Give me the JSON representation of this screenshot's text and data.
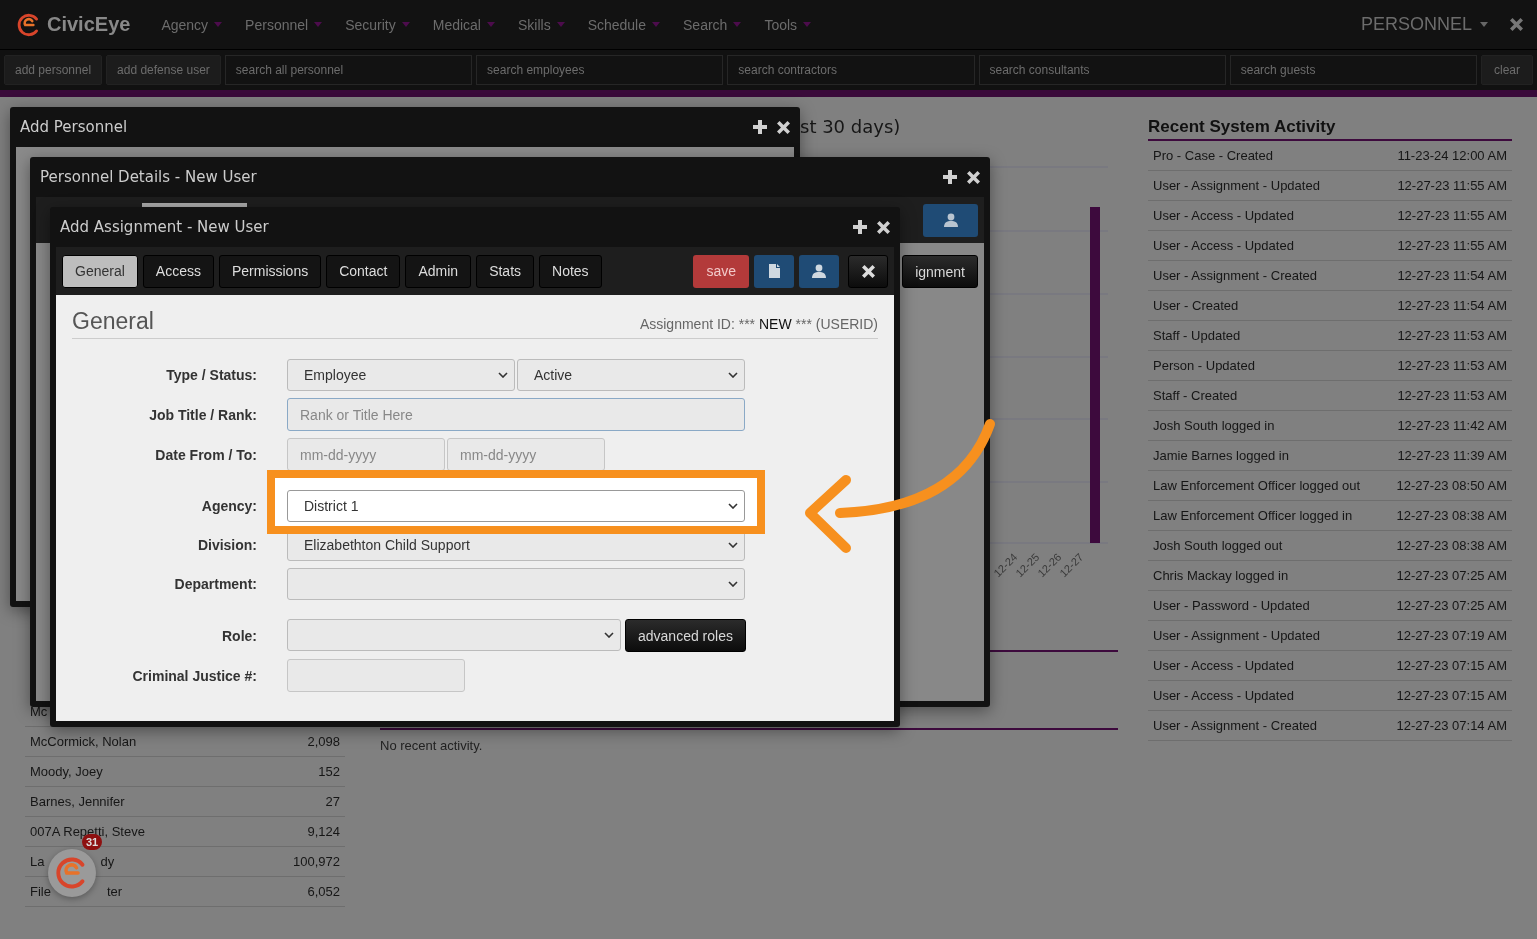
{
  "nav": {
    "brand": "CivicEye",
    "menus": [
      "Agency",
      "Personnel",
      "Security",
      "Medical",
      "Skills",
      "Schedule",
      "Search",
      "Tools"
    ],
    "context": "PERSONNEL"
  },
  "toolbar": {
    "buttons": [
      "add personnel",
      "add defense user"
    ],
    "search_placeholders": [
      "search all personnel",
      "search employees",
      "search contractors",
      "search consultants",
      "search guests"
    ],
    "clear": "clear"
  },
  "leaderboard": {
    "rows": [
      {
        "name": "Mc"
      },
      {
        "name": "McCormick, Nolan",
        "count": "2,098"
      },
      {
        "name": "Moody, Joey",
        "count": "152"
      },
      {
        "name": "Barnes, Jennifer",
        "count": "27"
      },
      {
        "name": "007A Repetti, Steve",
        "count": "9,124"
      },
      {
        "name": "La",
        "name_tail": "dy",
        "count": "100,972"
      },
      {
        "name": "File",
        "name_tail": "ter",
        "count": "6,052"
      }
    ]
  },
  "chart_panel": {
    "title": "st 30 days)",
    "x_labels": [
      "12-24",
      "12-25",
      "12-26",
      "12-27"
    ],
    "empty_text": "No recent activity."
  },
  "activity": {
    "title": "Recent System Activity",
    "rows": [
      {
        "event": "Pro - Case - Created",
        "time": "11-23-24 12:00 AM"
      },
      {
        "event": "User - Assignment - Updated",
        "time": "12-27-23 11:55 AM"
      },
      {
        "event": "User - Access - Updated",
        "time": "12-27-23 11:55 AM"
      },
      {
        "event": "User - Access - Updated",
        "time": "12-27-23 11:55 AM"
      },
      {
        "event": "User - Assignment - Created",
        "time": "12-27-23 11:54 AM"
      },
      {
        "event": "User - Created",
        "time": "12-27-23 11:54 AM"
      },
      {
        "event": "Staff - Updated",
        "time": "12-27-23 11:53 AM"
      },
      {
        "event": "Person - Updated",
        "time": "12-27-23 11:53 AM"
      },
      {
        "event": "Staff - Created",
        "time": "12-27-23 11:53 AM"
      },
      {
        "event": "Josh South logged in",
        "time": "12-27-23 11:42 AM"
      },
      {
        "event": "Jamie Barnes logged in",
        "time": "12-27-23 11:39 AM"
      },
      {
        "event": "Law Enforcement Officer logged out",
        "time": "12-27-23 08:50 AM"
      },
      {
        "event": "Law Enforcement Officer logged in",
        "time": "12-27-23 08:38 AM"
      },
      {
        "event": "Josh South logged out",
        "time": "12-27-23 08:38 AM"
      },
      {
        "event": "Chris Mackay logged in",
        "time": "12-27-23 07:25 AM"
      },
      {
        "event": "User - Password - Updated",
        "time": "12-27-23 07:25 AM"
      },
      {
        "event": "User - Assignment - Updated",
        "time": "12-27-23 07:19 AM"
      },
      {
        "event": "User - Access - Updated",
        "time": "12-27-23 07:15 AM"
      },
      {
        "event": "User - Access - Updated",
        "time": "12-27-23 07:15 AM"
      },
      {
        "event": "User - Assignment - Created",
        "time": "12-27-23 07:14 AM"
      }
    ]
  },
  "add_personnel_window": {
    "title": "Add Personnel"
  },
  "personnel_details_window": {
    "title": "Personnel Details - New User",
    "button": "ignment"
  },
  "assignment_window": {
    "title": "Add Assignment - New User",
    "tabs": [
      {
        "label": "General",
        "selected": true
      },
      {
        "label": "Access",
        "selected": false
      },
      {
        "label": "Permissions",
        "selected": false
      },
      {
        "label": "Contact",
        "selected": false
      },
      {
        "label": "Admin",
        "selected": false
      },
      {
        "label": "Stats",
        "selected": false
      },
      {
        "label": "Notes",
        "selected": false
      }
    ],
    "save": "save",
    "section": "General",
    "assignment_id": {
      "prefix": "Assignment ID: ***",
      "value": "NEW",
      "suffix": "*** (USERID)"
    },
    "fields": [
      {
        "kind": "select_pair",
        "label": "Type / Status:",
        "values": [
          "Employee",
          "Active"
        ]
      },
      {
        "kind": "text",
        "label": "Job Title / Rank:",
        "placeholder": "Rank or Title Here",
        "focused": true
      },
      {
        "kind": "date_pair",
        "label": "Date From / To:",
        "placeholders": [
          "mm-dd-yyyy",
          "mm-dd-yyyy"
        ]
      },
      {
        "kind": "select",
        "label": "Agency:",
        "value": "District 1",
        "highlighted": true
      },
      {
        "kind": "select",
        "label": "Division:",
        "value": "Elizabethton Child Support"
      },
      {
        "kind": "select",
        "label": "Department:"
      },
      {
        "kind": "select_button",
        "label": "Role:",
        "button": "advanced roles"
      },
      {
        "kind": "short_text",
        "label": "Criminal Justice #:"
      }
    ]
  },
  "chat_badge": {
    "count": "31"
  }
}
